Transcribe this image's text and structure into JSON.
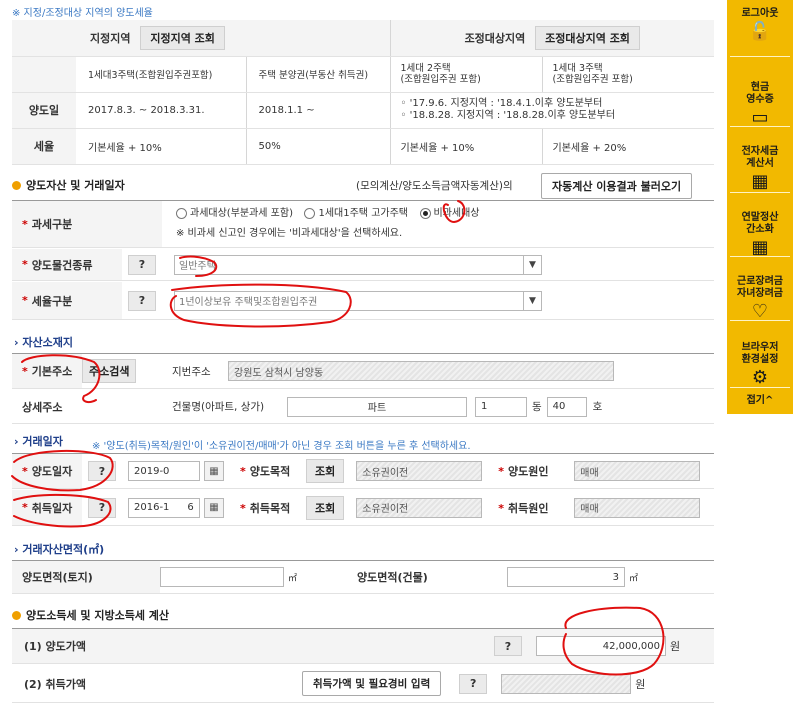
{
  "note_top": "※ 지정/조정대상 지역의 양도세율",
  "rate_table": {
    "designated": "지정지역",
    "designated_btn": "지정지역 조회",
    "adjusted": "조정대상지역",
    "adjusted_btn": "조정대상지역 조회",
    "col_1": "1세대3주택(조합원입주권포함)",
    "col_2": "주택 분양권(부동산 취득권)",
    "col_3": "1세대 2주택\n(조합원입주권 포함)",
    "col_4": "1세대 3주택\n(조합원입주권 포함)",
    "row_transfer_label": "양도일",
    "row_transfer_1": "2017.8.3. ~ 2018.3.31.",
    "row_transfer_2": "2018.1.1 ~",
    "row_transfer_3a": "◦ '17.9.6. 지정지역 : '18.4.1.이후 양도분부터",
    "row_transfer_3b": "◦ '18.8.28. 지정지역 : '18.8.28.이후 양도분부터",
    "row_rate_label": "세율",
    "rate_1": "기본세율 + 10%",
    "rate_2": "50%",
    "rate_3": "기본세율 + 10%",
    "rate_4": "기본세율 + 20%"
  },
  "section1": {
    "title": "양도자산 및 거래일자",
    "mock_text": "(모의계산/양도소득금액자동계산)의",
    "load_btn": "자동계산 이용결과 불러오기"
  },
  "tax_class": {
    "label": "과세구분",
    "opt1": "과세대상(부분과세 포함)",
    "opt2": "1세대1주택 고가주택",
    "opt3": "비과세대상",
    "hint": "※ 비과세 신고인 경우에는 '비과세대상'을 선택하세요."
  },
  "building_type": {
    "label": "양도물건종류",
    "q": "?",
    "value": "일반주택"
  },
  "tax_rate_type": {
    "label": "세율구분",
    "q": "?",
    "value": "1년이상보유 주택및조합원입주권"
  },
  "asset_location": {
    "title": "자산소재지",
    "base_label": "기본주소",
    "search_btn": "주소검색",
    "lot_label": "지번주소",
    "lot_value": "강원도 삼척시 남양동",
    "detail_label": "상세주소",
    "building_label": "건물명(아파트, 상가)",
    "building_value": "파트",
    "dong_value": "1",
    "dong_unit": "동",
    "ho_value": "40",
    "ho_unit": "호"
  },
  "trade_date": {
    "title": "거래일자",
    "hint": "※ '양도(취득)목적/원인'이 '소유권이전/매매'가 아닌 경우 조회 버튼을 누른 후 선택하세요.",
    "sell_label": "양도일자",
    "sell_date": "2019-0",
    "sell_purpose_label": "양도목적",
    "lookup_btn": "조회",
    "sell_purpose": "소유권이전",
    "sell_cause_label": "양도원인",
    "sell_cause": "매매",
    "buy_label": "취득일자",
    "buy_date": "2016-1",
    "buy_date_tail": "6",
    "buy_purpose_label": "취득목적",
    "buy_purpose": "소유권이전",
    "buy_cause_label": "취득원인",
    "buy_cause": "매매",
    "q": "?"
  },
  "area": {
    "title": "거래자산면적(㎡)",
    "land_label": "양도면적(토지)",
    "land_unit": "㎡",
    "bldg_label": "양도면적(건물)",
    "bldg_value": "3",
    "bldg_unit": "㎡"
  },
  "section2": {
    "title": "양도소득세 및 지방소득세 계산"
  },
  "calc": {
    "sale_label": "(1) 양도가액",
    "sale_value": "42,000,000",
    "won": "원",
    "acq_label": "(2) 취득가액",
    "acq_btn": "취득가액 및 필요경비 입력",
    "q": "?"
  },
  "sidebar": {
    "logout": "로그아웃",
    "cash_receipt": "현금\n영수증",
    "e_invoice": "전자세금\n계산서",
    "year_end": "연말정산\n간소화",
    "work_incentive": "근로장려금\n자녀장려금",
    "browser_setup": "브라우저\n환경설정",
    "close": "접기^"
  }
}
